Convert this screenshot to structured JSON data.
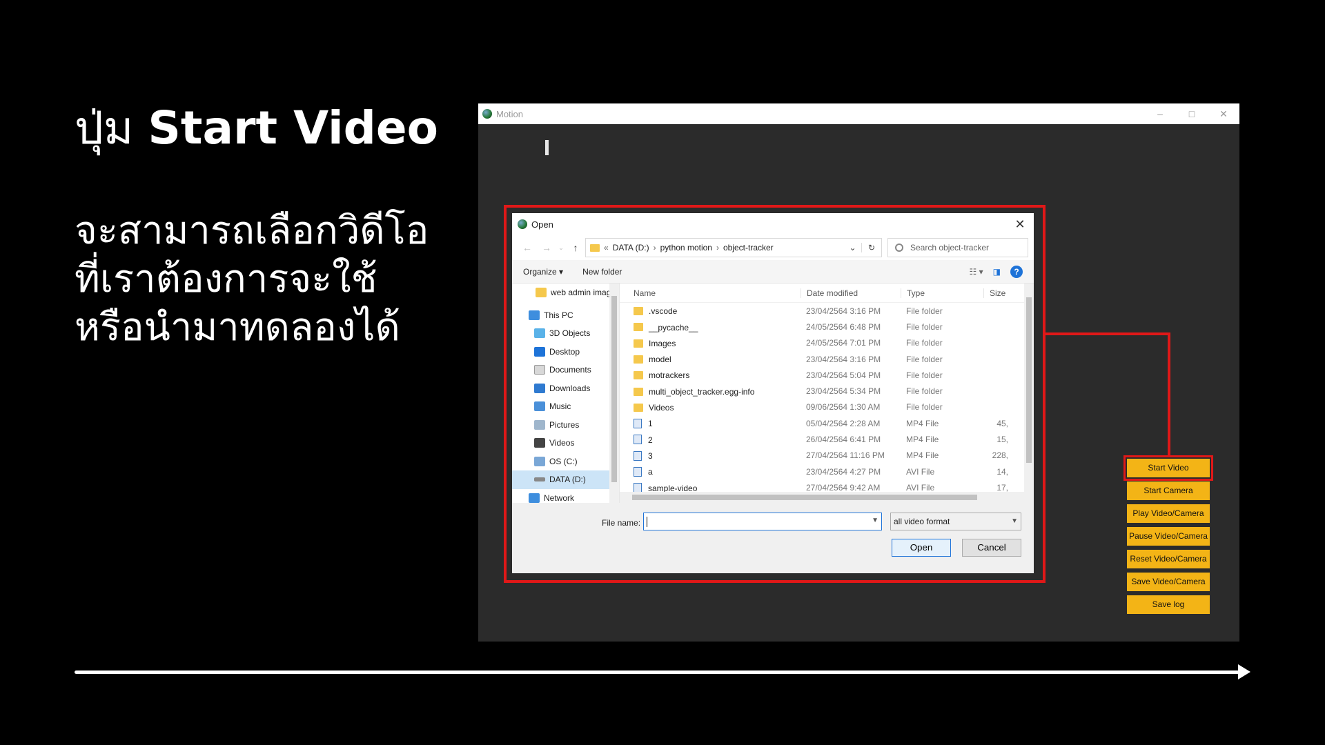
{
  "slide": {
    "title_prefix": "ปุ่ม",
    "title_bold": "Start Video",
    "body_lines": [
      "จะสามารถเลือกวิดีโอ",
      "ที่เราต้องการจะใช้",
      "หรือนำมาทดลองได้"
    ]
  },
  "app": {
    "title": "Motion",
    "buttons": [
      "Start Video",
      "Start Camera",
      "Play Video/Camera",
      "Pause Video/Camera",
      "Reset Video/Camera",
      "Save Video/Camera",
      "Save log"
    ]
  },
  "dialog": {
    "title": "Open",
    "breadcrumb": [
      "DATA (D:)",
      "python motion",
      "object-tracker"
    ],
    "search_placeholder": "Search object-tracker",
    "organize_label": "Organize ▾",
    "new_folder_label": "New folder",
    "nav_items": [
      "web admin imag",
      "This PC",
      "3D Objects",
      "Desktop",
      "Documents",
      "Downloads",
      "Music",
      "Pictures",
      "Videos",
      "OS (C:)",
      "DATA (D:)",
      "Network"
    ],
    "columns": [
      "Name",
      "Date modified",
      "Type",
      "Size"
    ],
    "files": [
      {
        "name": ".vscode",
        "date": "23/04/2564 3:16 PM",
        "type": "File folder",
        "size": "",
        "kind": "folder"
      },
      {
        "name": "__pycache__",
        "date": "24/05/2564 6:48 PM",
        "type": "File folder",
        "size": "",
        "kind": "folder"
      },
      {
        "name": "Images",
        "date": "24/05/2564 7:01 PM",
        "type": "File folder",
        "size": "",
        "kind": "folder"
      },
      {
        "name": "model",
        "date": "23/04/2564 3:16 PM",
        "type": "File folder",
        "size": "",
        "kind": "folder"
      },
      {
        "name": "motrackers",
        "date": "23/04/2564 5:04 PM",
        "type": "File folder",
        "size": "",
        "kind": "folder"
      },
      {
        "name": "multi_object_tracker.egg-info",
        "date": "23/04/2564 5:34 PM",
        "type": "File folder",
        "size": "",
        "kind": "folder"
      },
      {
        "name": "Videos",
        "date": "09/06/2564 1:30 AM",
        "type": "File folder",
        "size": "",
        "kind": "folder"
      },
      {
        "name": "1",
        "date": "05/04/2564 2:28 AM",
        "type": "MP4 File",
        "size": "45,",
        "kind": "file"
      },
      {
        "name": "2",
        "date": "26/04/2564 6:41 PM",
        "type": "MP4 File",
        "size": "15,",
        "kind": "file"
      },
      {
        "name": "3",
        "date": "27/04/2564 11:16 PM",
        "type": "MP4 File",
        "size": "228,",
        "kind": "file"
      },
      {
        "name": "a",
        "date": "23/04/2564 4:27 PM",
        "type": "AVI File",
        "size": "14,",
        "kind": "file"
      },
      {
        "name": "sample-video",
        "date": "27/04/2564 9:42 AM",
        "type": "AVI File",
        "size": "17,",
        "kind": "file"
      }
    ],
    "filename_label": "File name:",
    "filename_value": "",
    "filetype_value": "all video format",
    "open_label": "Open",
    "cancel_label": "Cancel"
  },
  "colors": {
    "accent_button": "#f3b416",
    "highlight": "#e01818"
  }
}
